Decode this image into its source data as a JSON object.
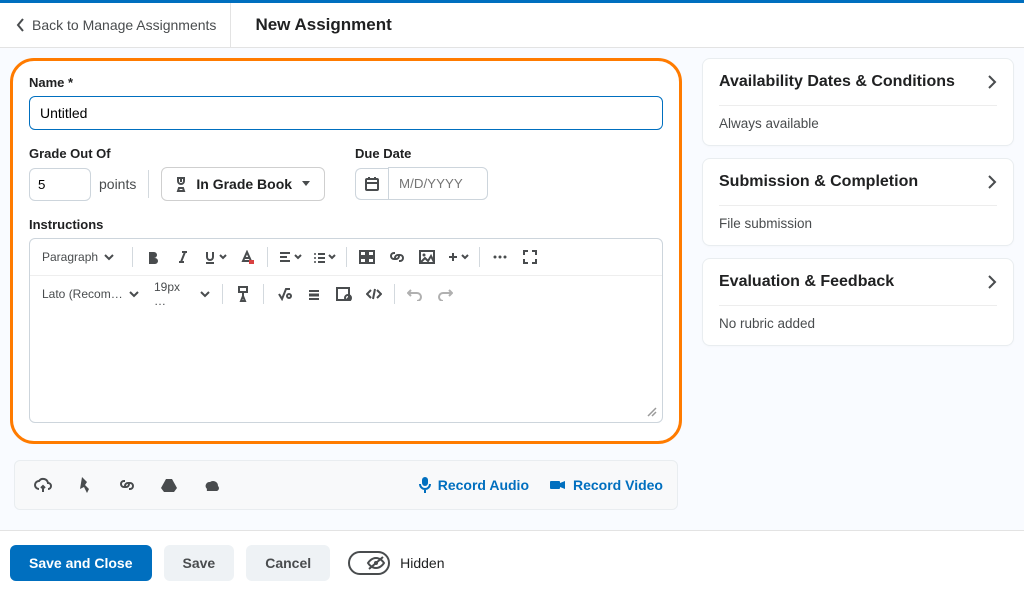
{
  "header": {
    "back_label": "Back to Manage Assignments",
    "title": "New Assignment"
  },
  "form": {
    "name_label": "Name *",
    "name_value": "Untitled",
    "grade_label": "Grade Out Of",
    "grade_value": "5",
    "points_label": "points",
    "gradebook_label": "In Grade Book",
    "due_label": "Due Date",
    "due_placeholder": "M/D/YYYY",
    "instructions_label": "Instructions"
  },
  "editor": {
    "block_format": "Paragraph",
    "font_family": "Lato (Recom…",
    "font_size": "19px …"
  },
  "media": {
    "record_audio": "Record Audio",
    "record_video": "Record Video"
  },
  "sidebar": {
    "panels": [
      {
        "title": "Availability Dates & Conditions",
        "subtitle": "Always available"
      },
      {
        "title": "Submission & Completion",
        "subtitle": "File submission"
      },
      {
        "title": "Evaluation & Feedback",
        "subtitle": "No rubric added"
      }
    ]
  },
  "footer": {
    "save_close": "Save and Close",
    "save": "Save",
    "cancel": "Cancel",
    "visibility": "Hidden"
  }
}
